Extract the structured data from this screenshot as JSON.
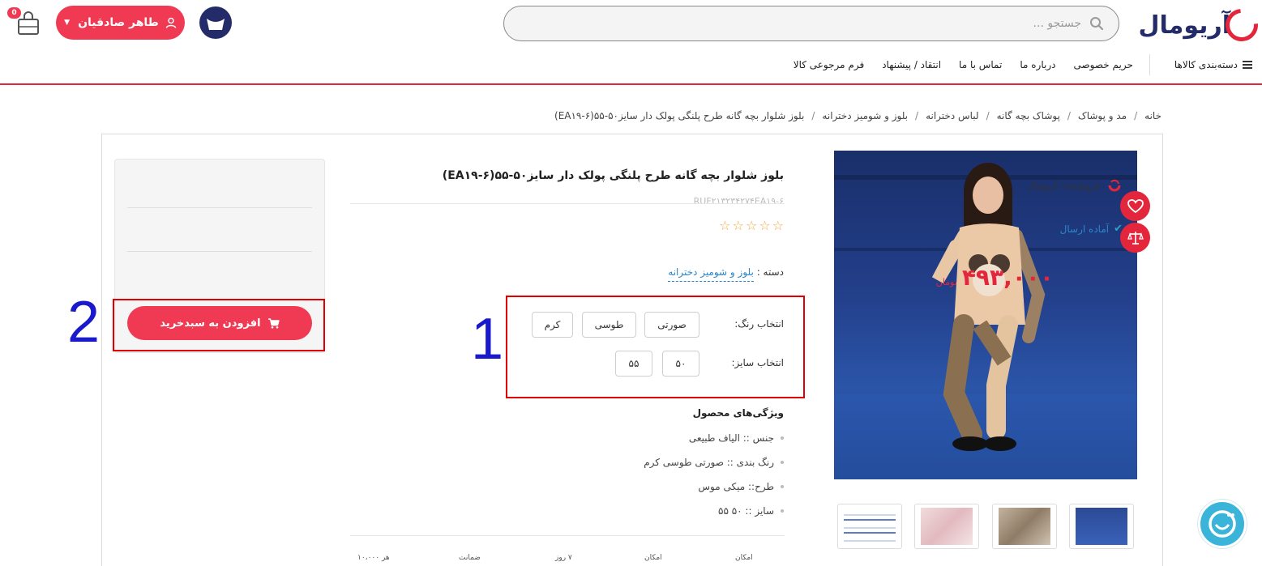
{
  "header": {
    "logo_text": "آریومال",
    "search_placeholder": "جستجو ...",
    "user_name": "طاهر صادقیان",
    "cart_count": "0"
  },
  "nav": {
    "categories_label": "دسته‌بندی کالاها",
    "links": [
      "حریم خصوصی",
      "درباره ما",
      "تماس با ما",
      "انتقاد / پیشنهاد",
      "فرم مرجوعی کالا"
    ]
  },
  "breadcrumb": [
    "خانه",
    "مد و پوشاک",
    "پوشاک بچه گانه",
    "لباس دخترانه",
    "بلوز و شومیز دخترانه",
    "بلوز شلوار بچه گانه طرح پلنگی پولک دار سایز۵۰-۵۵(EA۱۹-۶)"
  ],
  "product": {
    "title": "بلوز شلوار بچه گانه طرح پلنگی پولک دار سایز۵۰-۵۵(EA۱۹-۶)",
    "sku": "RUF۲۱۳۲۳۴۲۷۴EA۱۹-۶",
    "stars_total": 5,
    "stars_filled": 0,
    "category_label": "دسته :",
    "category_value": "بلوز و شومیز دخترانه",
    "color_label": "انتخاب رنگ:",
    "colors": [
      "صورتی",
      "طوسی",
      "کرم"
    ],
    "size_label": "انتخاب سایز:",
    "sizes": [
      "۵۰",
      "۵۵"
    ],
    "features_title": "ویژگی‌های محصول",
    "features": [
      "جنس :: الیاف طبیعی",
      "رنگ بندی :: صورتی طوسی کرم",
      "طرح:: میکی موس",
      "سایز :: ۵۰ ۵۵"
    ],
    "badges": [
      "امکان",
      "امکان",
      "۷ روز",
      "ضمانت",
      "هر ۱۰،۰۰۰"
    ]
  },
  "seller": {
    "seller_label": "فروشنده: آریومال",
    "status": "آماده ارسال",
    "price": "۴۹۳,۰۰۰",
    "currency": "تومان",
    "add_to_cart": "افزودن به سبدخرید"
  },
  "annotations": [
    "1",
    "2"
  ],
  "colors": {
    "accent": "#f03952",
    "brand_navy": "#232c68",
    "link": "#2a86c8",
    "annotation_box": "#e00000",
    "annotation_number": "#1a1acc"
  }
}
